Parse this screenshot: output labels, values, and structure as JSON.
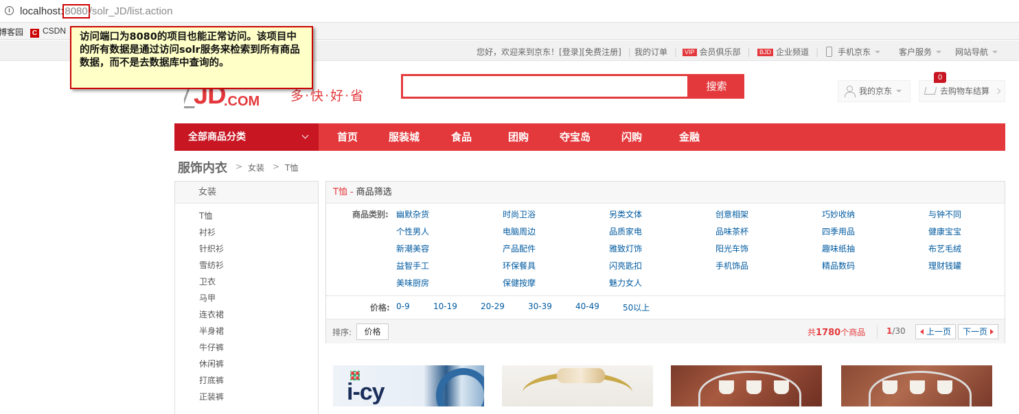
{
  "browser": {
    "url_host": "localhost:",
    "url_port": "8080",
    "url_path": "/solr_JD/list.action",
    "bookmarks": [
      "博客园",
      "CSDN"
    ]
  },
  "annotation": {
    "text": "访问端口为8080的项目也能正常访问。该项目中的所有数据是通过访问solr服务来检索到所有商品数据，而不是去数据库中查询的。"
  },
  "topnav": {
    "welcome": "您好，欢迎来到京东！",
    "login": "[登录]",
    "register": "[免费注册]",
    "my_orders": "我的订单",
    "vip_badge": "VIP",
    "vip_club": "会员俱乐部",
    "bjd_badge": "BJD",
    "enterprise": "企业频道",
    "mobile": "手机京东",
    "service": "客户服务",
    "site_nav": "网站导航"
  },
  "header": {
    "logo_jd": "JD",
    "logo_com": ".COM",
    "slogan": "多·快·好·省",
    "search_placeholder": "",
    "search_button": "搜索",
    "my_jd": "我的京东",
    "cart_label": "去购物车结算",
    "cart_count": "0"
  },
  "mainnav": {
    "all_categories": "全部商品分类",
    "items": [
      "首页",
      "服装城",
      "食品",
      "团购",
      "夺宝岛",
      "闪购",
      "金融"
    ]
  },
  "breadcrumb": {
    "root": "服饰内衣",
    "level1": "女装",
    "level2": "T恤"
  },
  "sidebar": {
    "heading": "女装",
    "items": [
      "T恤",
      "衬衫",
      "针织衫",
      "雪纺衫",
      "卫衣",
      "马甲",
      "连衣裙",
      "半身裙",
      "牛仔裤",
      "休闲裤",
      "打底裤",
      "正装裤"
    ]
  },
  "filter": {
    "title_cat": "T恤",
    "title_sep": "-",
    "title_text": "商品筛选",
    "category_label": "商品类别:",
    "categories": [
      [
        "幽默杂货",
        "时尚卫浴",
        "另类文体",
        "创意相架",
        "巧妙收纳",
        "与钟不同"
      ],
      [
        "个性男人",
        "电脑周边",
        "品质家电",
        "品味茶杯",
        "四季用品",
        "健康宝宝"
      ],
      [
        "新潮美容",
        "产品配件",
        "雅致灯饰",
        "阳光车饰",
        "趣味纸抽",
        "布艺毛绒"
      ],
      [
        "益智手工",
        "环保餐具",
        "闪亮匙扣",
        "手机饰品",
        "精品数码",
        "理财钱罐"
      ],
      [
        "美味厨房",
        "保健按摩",
        "魅力女人"
      ]
    ],
    "price_label": "价格:",
    "prices": [
      "0-9",
      "10-19",
      "20-29",
      "30-39",
      "40-49",
      "50以上"
    ],
    "sort_label": "排序:",
    "sort_price": "价格",
    "total_prefix": "共",
    "total_count": "1780",
    "total_suffix": "个商品",
    "page_current": "1",
    "page_total": "/30",
    "prev_page": "上一页",
    "next_page": "下一页"
  },
  "products": {
    "p1_brand": "i-cy"
  }
}
